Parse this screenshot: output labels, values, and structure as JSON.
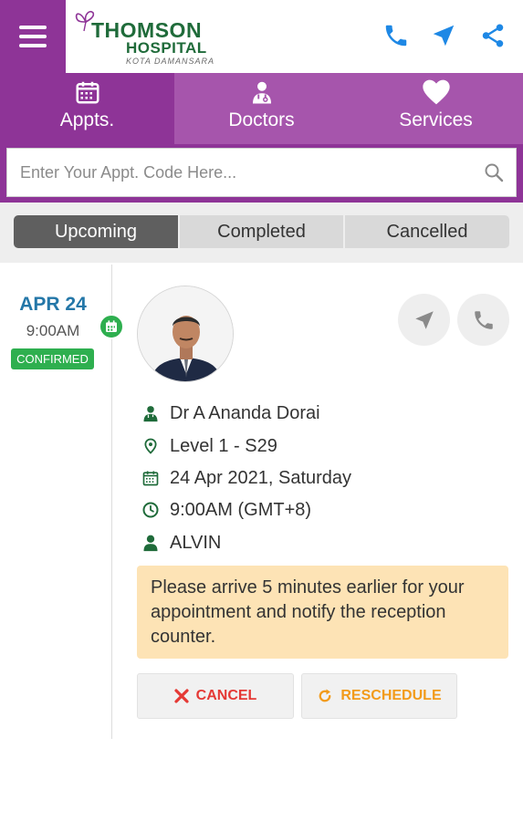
{
  "header": {
    "menu_icon": "hamburger-menu-icon",
    "logo": {
      "line1": "THOMSON",
      "line2": "HOSPITAL",
      "line3": "KOTA DAMANSARA"
    },
    "actions": [
      "phone-icon",
      "navigate-arrow-icon",
      "share-icon"
    ],
    "accent_color": "#8e3497"
  },
  "nav": {
    "tabs": [
      {
        "label": "Appts.",
        "icon": "calendar-icon",
        "active": true
      },
      {
        "label": "Doctors",
        "icon": "doctor-icon",
        "active": false
      },
      {
        "label": "Services",
        "icon": "heart-icon",
        "active": false
      }
    ]
  },
  "search": {
    "placeholder": "Enter Your Appt. Code Here...",
    "value": ""
  },
  "segments": {
    "items": [
      {
        "label": "Upcoming",
        "active": true
      },
      {
        "label": "Completed",
        "active": false
      },
      {
        "label": "Cancelled",
        "active": false
      }
    ]
  },
  "appointment": {
    "date_short": "APR 24",
    "time_short": "9:00AM",
    "status": "CONFIRMED",
    "status_color": "#2eaf4f",
    "doctor": "Dr A Ananda Dorai",
    "location": "Level 1 - S29",
    "date_full": "24 Apr 2021, Saturday",
    "time_full": "9:00AM (GMT+8)",
    "patient": "ALVIN",
    "notice": "Please arrive 5 minutes earlier for your appointment and notify the reception counter.",
    "cancel_label": "CANCEL",
    "reschedule_label": "RESCHEDULE"
  }
}
